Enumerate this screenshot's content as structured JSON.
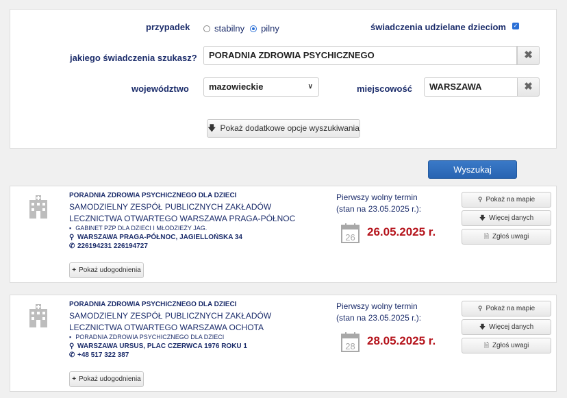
{
  "search": {
    "case_label": "przypadek",
    "case_options": [
      "stabilny",
      "pilny"
    ],
    "case_selected": "pilny",
    "children_label": "świadczenia udzielane dzieciom",
    "children_checked": true,
    "service_label": "jakiego świadczenia szukasz?",
    "service_value": "PORADNIA ZDROWIA PSYCHICZNEGO",
    "province_label": "województwo",
    "province_value": "mazowieckie",
    "city_label": "miejscowość",
    "city_value": "WARSZAWA",
    "more_options_label": "Pokaż dodatkowe opcje wyszukiwania",
    "search_button_label": "Wyszukaj"
  },
  "results": [
    {
      "title": "PORADNIA ZDROWIA PSYCHICZNEGO DLA DZIECI",
      "org": "SAMODZIELNY ZESPÓŁ PUBLICZNYCH ZAKŁADÓW LECZNICTWA OTWARTEGO WARSZAWA PRAGA-PÓŁNOC",
      "unit": "GABINET PZP DLA DZIECI I MŁODZIEŻY JAG.",
      "address": "WARSZAWA PRAGA-PÓŁNOC, JAGIELLOŃSKA 34",
      "phone": "226194231 226194727",
      "amenities_label": "Pokaż udogodnienia",
      "term_label": "Pierwszy wolny termin",
      "term_state": "(stan na 23.05.2025 r.):",
      "calendar_day": "26",
      "term_date": "26.05.2025 r.",
      "map_label": "Pokaż na mapie",
      "details_label": "Więcej danych",
      "report_label": "Zgłoś uwagi"
    },
    {
      "title": "PORADNIA ZDROWIA PSYCHICZNEGO DLA DZIECI",
      "org": "SAMODZIELNY ZESPÓŁ PUBLICZNYCH ZAKŁADÓW LECZNICTWA OTWARTEGO WARSZAWA OCHOTA",
      "unit": "PORADNIA ZDROWIA PSYCHICZNEGO DLA DZIECI",
      "address": "WARSZAWA URSUS, PLAC CZERWCA 1976 ROKU 1",
      "phone": "+48 517 322 387",
      "amenities_label": "Pokaż udogodnienia",
      "term_label": "Pierwszy wolny termin",
      "term_state": "(stan na 23.05.2025 r.):",
      "calendar_day": "28",
      "term_date": "28.05.2025 r.",
      "map_label": "Pokaż na mapie",
      "details_label": "Więcej danych",
      "report_label": "Zgłoś uwagi"
    }
  ],
  "colors": {
    "label_navy": "#1c2d6b",
    "date_red": "#b5141c",
    "primary_blue": "#2864b2"
  }
}
